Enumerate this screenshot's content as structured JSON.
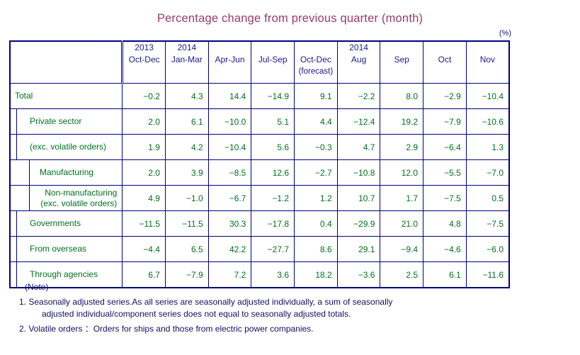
{
  "title": "Percentage change from previous quarter (month)",
  "unit": "(%)",
  "colors": {
    "title": "#9a3a6a",
    "label": "#1a1a8c",
    "value": "#00701e",
    "border": "#000080"
  },
  "table": {
    "quarter_headers": [
      {
        "year": "2013",
        "span": "Oct-Dec",
        "sub": ""
      },
      {
        "year": "2014",
        "span": "Jan-Mar",
        "sub": ""
      },
      {
        "year": "",
        "span": "Apr-Jun",
        "sub": ""
      },
      {
        "year": "",
        "span": "Jul-Sep",
        "sub": ""
      },
      {
        "year": "",
        "span": "Oct-Dec",
        "sub": "(forecast)"
      }
    ],
    "month_headers": [
      {
        "year": "2014",
        "span": "Aug"
      },
      {
        "year": "",
        "span": "Sep"
      },
      {
        "year": "",
        "span": "Oct"
      },
      {
        "year": "",
        "span": "Nov"
      }
    ],
    "rows": [
      {
        "label": "Total",
        "label2": "",
        "indent": 0,
        "values": [
          "-0.2",
          "4.3",
          "14.4",
          "-14.9",
          "9.1",
          "-2.2",
          "8.0",
          "-2.9",
          "-10.4"
        ]
      },
      {
        "label": "Private sector",
        "label2": "",
        "indent": 1,
        "values": [
          "2.0",
          "6.1",
          "-10.0",
          "5.1",
          "4.4",
          "-12.4",
          "19.2",
          "-7.9",
          "-10.6"
        ]
      },
      {
        "label": "(exc. volatile orders)",
        "label2": "",
        "indent": 1,
        "values": [
          "1.9",
          "4.2",
          "-10.4",
          "5.6",
          "-0.3",
          "4.7",
          "2.9",
          "-6.4",
          "1.3"
        ]
      },
      {
        "label": "Manufacturing",
        "label2": "",
        "indent": 2,
        "values": [
          "2.0",
          "3.9",
          "-8.5",
          "12.6",
          "-2.7",
          "-10.8",
          "12.0",
          "-5.5",
          "-7.0"
        ]
      },
      {
        "label": "Non-manufacturing",
        "label2": "(exc. volatile orders)",
        "indent": 2,
        "values": [
          "4.9",
          "-1.0",
          "-6.7",
          "-1.2",
          "1.2",
          "10.7",
          "1.7",
          "-7.5",
          "0.5"
        ]
      },
      {
        "label": "Governments",
        "label2": "",
        "indent": 1,
        "values": [
          "-11.5",
          "-11.5",
          "30.3",
          "-17.8",
          "0.4",
          "-29.9",
          "21.0",
          "4.8",
          "-7.5"
        ]
      },
      {
        "label": "From overseas",
        "label2": "",
        "indent": 1,
        "values": [
          "-4.4",
          "6.5",
          "42.2",
          "-27.7",
          "8.6",
          "29.1",
          "-9.4",
          "-4.6",
          "-6.0"
        ]
      },
      {
        "label": "Through agencies",
        "label2": "",
        "indent": 1,
        "values": [
          "6.7",
          "-7.9",
          "7.2",
          "3.6",
          "18.2",
          "-3.6",
          "2.5",
          "6.1",
          "-11.6"
        ]
      }
    ]
  },
  "notes": {
    "heading": "(Note)",
    "items": [
      {
        "line1": "1. Seasonally adjusted series.As all series are seasonally adjusted individually,  a sum of seasonally",
        "line2": "adjusted individual/component series does not equal to seasonally adjusted totals."
      },
      {
        "line1": "2. Volatile orders ：Orders for ships and those from electric power companies.",
        "line2": ""
      }
    ]
  }
}
